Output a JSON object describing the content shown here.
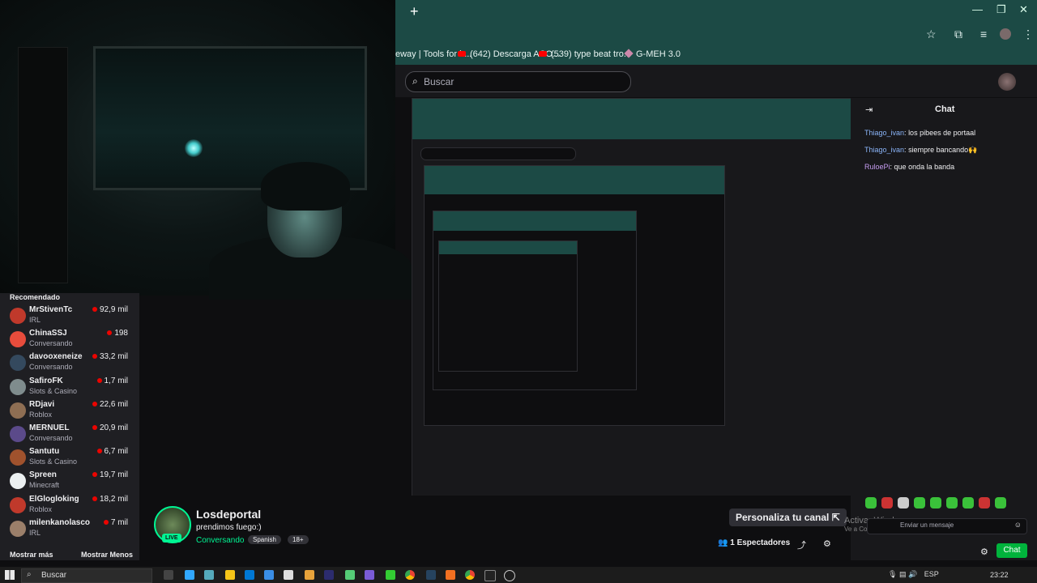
{
  "browser": {
    "new_tab_icon": "+",
    "window_controls": [
      "—",
      "❐",
      "✕"
    ],
    "bookmarks": [
      {
        "label": "eway | Tools for h...",
        "icon": "none"
      },
      {
        "label": "(642) Descarga ACO...",
        "icon": "youtube"
      },
      {
        "label": "(539) type beat tro...",
        "icon": "youtube"
      },
      {
        "label": "G-MEH 3.0",
        "icon": "generic"
      }
    ]
  },
  "twitch": {
    "search_placeholder": "Buscar",
    "sidebar": {
      "header": "Recomendado",
      "channels": [
        {
          "name": "MrStivenTc",
          "category": "IRL",
          "viewers": "92,9 mil",
          "color": "#c0392b"
        },
        {
          "name": "ChinaSSJ",
          "category": "Conversando",
          "viewers": "198",
          "color": "#e74c3c"
        },
        {
          "name": "davooxeneize",
          "category": "Conversando",
          "viewers": "33,2 mil",
          "color": "#34495e"
        },
        {
          "name": "SafiroFK",
          "category": "Slots & Casino",
          "viewers": "1,7 mil",
          "color": "#7f8c8d"
        },
        {
          "name": "RDjavi",
          "category": "Roblox",
          "viewers": "22,6 mil",
          "color": "#8e6e53"
        },
        {
          "name": "MERNUEL",
          "category": "Conversando",
          "viewers": "20,9 mil",
          "color": "#5b4a8a"
        },
        {
          "name": "Santutu",
          "category": "Slots & Casino",
          "viewers": "6,7 mil",
          "color": "#a0522d"
        },
        {
          "name": "Spreen",
          "category": "Minecraft",
          "viewers": "19,7 mil",
          "color": "#ecf0f1"
        },
        {
          "name": "ElGlogloking",
          "category": "Roblox",
          "viewers": "18,2 mil",
          "color": "#c0392b"
        },
        {
          "name": "milenkanolasco",
          "category": "IRL",
          "viewers": "7 mil",
          "color": "#9b7f6a"
        }
      ],
      "show_more": "Mostrar más",
      "show_less": "Mostrar Menos"
    },
    "stream": {
      "streamer": "Losdeportal",
      "live_badge": "LIVE",
      "title": "prendimos fuego:)",
      "category": "Conversando",
      "tags": [
        "Spanish",
        "18+"
      ],
      "customize_button": "Personaliza tu canal",
      "viewers_count": "1",
      "viewers_label": "Espectadores"
    },
    "chat": {
      "title": "Chat",
      "messages": [
        {
          "user": "Thiago_ivan",
          "text": "los pibees de portaal"
        },
        {
          "user": "Thiago_ivan",
          "text": "siempre bancando🙌"
        },
        {
          "user": "RuloePi",
          "text": "que onda la banda"
        }
      ],
      "input_placeholder": "Enviar un mensaje",
      "send_button": "Chat"
    }
  },
  "windows_overlay": {
    "line1": "Activar Windows",
    "line2": "Ve a Configuración para activar Windows."
  },
  "taskbar": {
    "search_placeholder": "Buscar",
    "language": "ESP",
    "clock": "23:22"
  }
}
